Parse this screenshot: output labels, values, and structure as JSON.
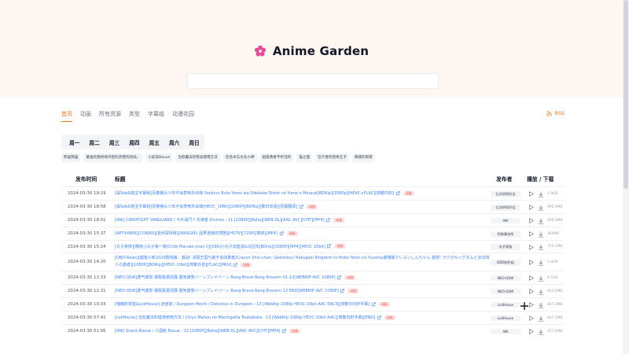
{
  "brand": {
    "title": "Anime Garden",
    "logo_icon": "sakura-flower-icon",
    "accent": "#ec4899"
  },
  "search": {
    "placeholder": ""
  },
  "nav": {
    "tabs": [
      {
        "label": "首页",
        "active": true
      },
      {
        "label": "动画"
      },
      {
        "label": "所有资源"
      },
      {
        "label": "类型"
      },
      {
        "label": "字幕组"
      },
      {
        "label": "动漫花园"
      }
    ],
    "rss": "RSS"
  },
  "weekdays": [
    "周一",
    "周二",
    "周三",
    "周四",
    "周五",
    "周六",
    "周日"
  ],
  "chips": [
    "熊猫熊猫",
    "最强的我终将开启的贪婪的抓续。",
    "小屁孩Basue",
    "治愈魔法的错误使用方法",
    "在名木与文岛小岬",
    "超级勇者不听话的",
    "猫之国",
    "在干者的猎骨王子",
    "薇德的刺客"
  ],
  "table": {
    "headers": {
      "time": "发布时间",
      "title": "标题",
      "publisher": "发布者",
      "actions": "播放 / 下载"
    },
    "rows": [
      {
        "time": "2024-03-30 19:19",
        "title": "[桜Sob&桃宝字幕组]青春猪头少年不会梦到外出妹 Seishun Buta Yarou wa Odekake Sister no Yume o Miranai[BDRip][1080p][HEVC+FLAC][简繁内封]",
        "badge": "动画",
        "publisher": "亿次研同好会",
        "size": "1.9GB"
      },
      {
        "time": "2024-03-30 18:58",
        "title": "[桜Sob&桃宝字幕组]青春猪头少年不会梦到外出妹[HEVC_10Bit][1080P][BDRip][繁日双语][招募翻译]",
        "badge": "动画",
        "publisher": "亿次研同好会",
        "size": "995.5MB"
      },
      {
        "time": "2024-03-30 18:01",
        "title": "[ANi] CARDFIGHT VANGUARD / 卡片战鬥!! 先導者 Divinez - 11 [1080P][Baha][WEB-DL][AAC AVC][CHT][MP4]",
        "badge": "动画",
        "publisher": "ANi",
        "size": "490.3MB"
      },
      {
        "time": "2024-03-30 15:37",
        "title": "[APTX4869][CONAN][名侦探柯南][990&991 因果连锁的悲剧][HDTV][720P][简体][MP4]",
        "badge": "动画",
        "publisher": "柯南事务所",
        "size": "360MB"
      },
      {
        "time": "2024-03-30 15:24",
        "title": "[丸子家族][樱桃小丸子第一期(Chibi Maruko-chan I)][096]小丸子去座谈&马拉松[BDrip][1080P][MP4][HEVC 10bit]",
        "badge": "动画",
        "publisher": "丸子家族",
        "size": "753.2MB"
      },
      {
        "time": "2024-03-30 14:20",
        "title": "[DBD-Raws][蜡笔小新2020剧场版：激战! 涂鸦王国与差不多四勇者/Crayon Shin-chan: Gekitotsu! Rakugaki Kingdom to Hobo Yonin no Yuusha/劇場版クレヨンしんちゃん 激突! ラクガキングダムとほぼ四人の勇者][1080P][BDRip][HEVC-10bit][简繁外挂][FLAC][MKV]",
        "badge": "动画",
        "publisher": "DBD制作组",
        "size": "5.4GB"
      },
      {
        "time": "2024-03-30 12:33",
        "title": "[NEO·QSW]勇气爆发 爆裂豪勇招展 勇気爆発バーンブレイバーン Bang Brave Bang Bravern 01-12[WEBRIP AVC 1080P]",
        "badge": "动画",
        "publisher": "NEO·QSW",
        "size": "6.5GB"
      },
      {
        "time": "2024-03-30 12:31",
        "title": "[NEO·QSW]勇气爆发 爆裂豪勇招展 勇気爆発バーンブレイバーン Bang Brave Bang Bravern 12 END[WEBRIP AVC 1080P]",
        "badge": "动画",
        "publisher": "NEO·QSW",
        "size": "404.0MB"
      },
      {
        "time": "2024-03-30 10:33",
        "title": "[喵萌奶茶屋&LoliHouse] 迷宫饭 / Dungeon Meshi / Delicious in Dungeon - 13 [WebRip 1080p HEVC-10bit AAC EAC3][简繁日内封字幕]",
        "badge": "动画",
        "publisher": "LoliHouse",
        "size": "667.3MB"
      },
      {
        "time": "2024-03-30 07:41",
        "title": "[LoliHouse] 治愈魔法的错误使用方法 / Chiyu Mahou no Machigatta Tsukaikata - 13 [WebRip 1080p HEVC-10bit AAC][简繁内封字幕][END]",
        "badge": "动画",
        "publisher": "LoliHouse",
        "size": "607.3MB"
      },
      {
        "time": "2024-03-30 01:06",
        "title": "[ANi] Snack Basue / 小酒館 Basue - 12 [1080P][Baha][WEB-DL][AAC AVC][CHT][MP4]",
        "badge": "动画",
        "publisher": "ANi",
        "size": "257.6MB"
      }
    ]
  }
}
